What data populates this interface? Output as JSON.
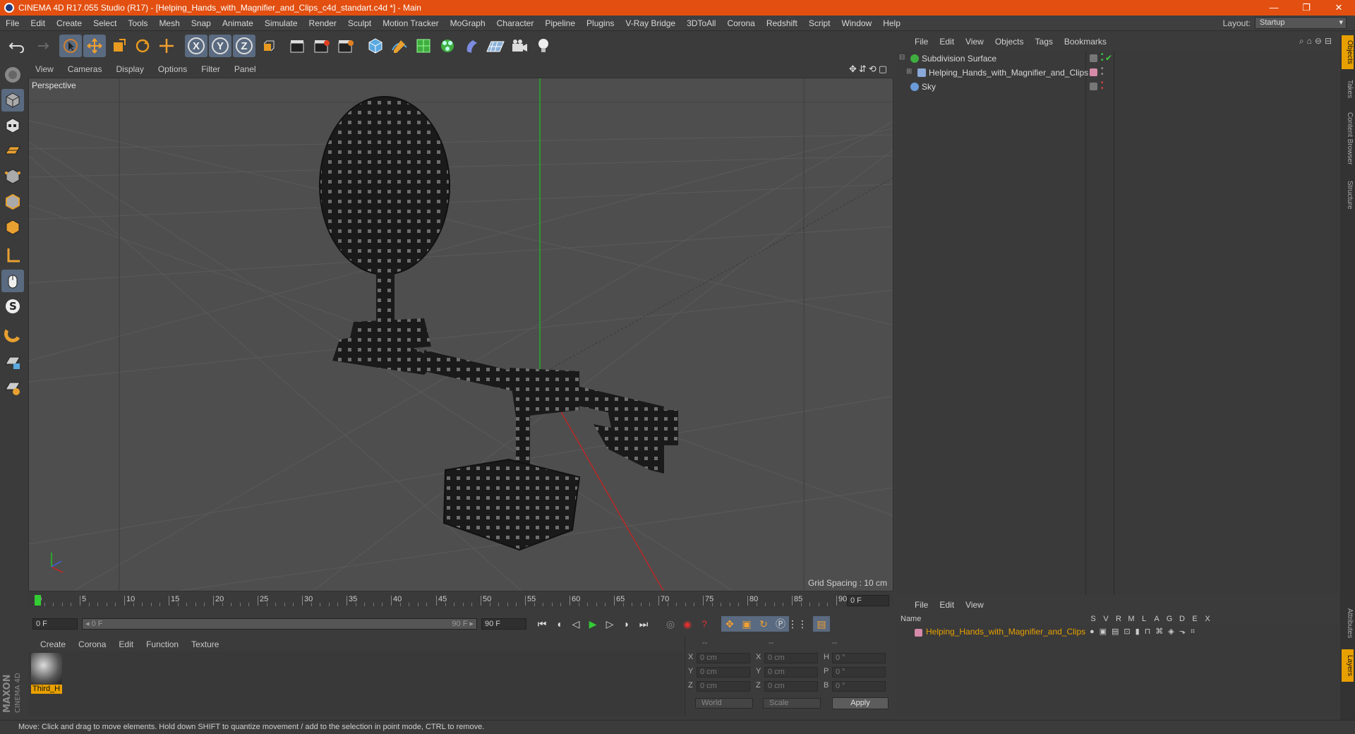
{
  "window": {
    "title": "CINEMA 4D R17.055 Studio (R17) - [Helping_Hands_with_Magnifier_and_Clips_c4d_standart.c4d *] - Main",
    "controls": [
      "—",
      "❐",
      "✕"
    ]
  },
  "menubar": {
    "items": [
      "File",
      "Edit",
      "Create",
      "Select",
      "Tools",
      "Mesh",
      "Snap",
      "Animate",
      "Simulate",
      "Render",
      "Sculpt",
      "Motion Tracker",
      "MoGraph",
      "Character",
      "Pipeline",
      "Plugins",
      "V-Ray Bridge",
      "3DToAll",
      "Corona",
      "Redshift",
      "Script",
      "Window",
      "Help"
    ],
    "layout_label": "Layout:",
    "layout_value": "Startup"
  },
  "toolbar": {
    "axis_x": "X",
    "axis_y": "Y",
    "axis_z": "Z"
  },
  "viewport": {
    "menu": [
      "View",
      "Cameras",
      "Display",
      "Options",
      "Filter",
      "Panel"
    ],
    "label": "Perspective",
    "grid_spacing": "Grid Spacing : 10 cm"
  },
  "timeline": {
    "ticks": [
      "0",
      "5",
      "10",
      "15",
      "20",
      "25",
      "30",
      "35",
      "40",
      "45",
      "50",
      "55",
      "60",
      "65",
      "70",
      "75",
      "80",
      "85",
      "90"
    ],
    "current_frame": "0 F",
    "start_field": "0 F",
    "range_start": "◂ 0 F",
    "range_end": "90 F ▸",
    "end_field": "90 F"
  },
  "material_manager": {
    "menu": [
      "Create",
      "Corona",
      "Edit",
      "Function",
      "Texture"
    ],
    "material_name": "Third_H"
  },
  "coordinates": {
    "headers": [
      "--",
      "--",
      "--"
    ],
    "rows": [
      {
        "l1": "X",
        "v1": "0 cm",
        "l2": "X",
        "v2": "0 cm",
        "l3": "H",
        "v3": "0 °"
      },
      {
        "l1": "Y",
        "v1": "0 cm",
        "l2": "Y",
        "v2": "0 cm",
        "l3": "P",
        "v3": "0 °"
      },
      {
        "l1": "Z",
        "v1": "0 cm",
        "l2": "Z",
        "v2": "0 cm",
        "l3": "B",
        "v3": "0 °"
      }
    ],
    "space": "World",
    "mode": "Scale",
    "apply": "Apply"
  },
  "object_manager": {
    "menu": [
      "File",
      "Edit",
      "View",
      "Objects",
      "Tags",
      "Bookmarks"
    ],
    "objects": [
      {
        "name": "Subdivision Surface",
        "icon_color": "#3fae3f"
      },
      {
        "name": "Helping_Hands_with_Magnifier_and_Clips",
        "icon_color": "#8aa8d8"
      },
      {
        "name": "Sky",
        "icon_color": "#6a9ad8"
      }
    ]
  },
  "layer_manager": {
    "menu": [
      "File",
      "Edit",
      "View"
    ],
    "header_name": "Name",
    "columns": [
      "S",
      "V",
      "R",
      "M",
      "L",
      "A",
      "G",
      "D",
      "E",
      "X"
    ],
    "layers": [
      {
        "name": "Helping_Hands_with_Magnifier_and_Clips",
        "color": "#d48aa8"
      }
    ]
  },
  "right_tabs": [
    "Objects",
    "Takes",
    "Content Browser",
    "Structure",
    "Attributes",
    "Layers"
  ],
  "status": "Move: Click and drag to move elements. Hold down SHIFT to quantize movement / add to the selection in point mode, CTRL to remove.",
  "colors": {
    "title_bar": "#e24f10",
    "accent": "#e8a000",
    "axis_y": "#20c020",
    "axis_x": "#d02020"
  }
}
